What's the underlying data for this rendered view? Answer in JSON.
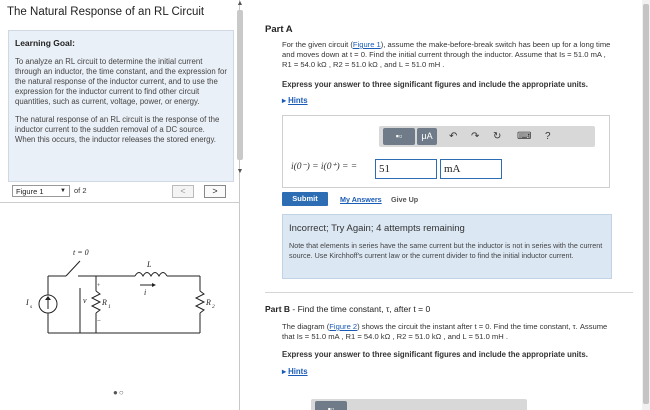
{
  "title": "The Natural Response of an RL Circuit",
  "learning_goal": {
    "heading": "Learning Goal:",
    "p1": "To analyze an RL circuit to determine the initial current through an inductor, the time constant, and the expression for the natural response of the inductor current, and to use the expression for the inductor current to find other circuit quantities, such as current, voltage, power, or energy.",
    "p2": "The natural response of an RL circuit is the response of the inductor current to the sudden removal of a DC source. When this occurs, the inductor releases the stored energy."
  },
  "figure_nav": {
    "select_value": "Figure 1",
    "of_label": "of 2",
    "prev": "<",
    "next": ">"
  },
  "circuit": {
    "switch_label": "t = 0",
    "inductor_label": "L",
    "source_label": "I",
    "source_sub": "s",
    "r1_label": "R",
    "r1_sub": "1",
    "r2_label": "R",
    "r2_sub": "2",
    "v_label": "v",
    "i_label": "i",
    "plus": "+",
    "minus": "−"
  },
  "carousel_dots": "●○",
  "partA": {
    "heading": "Part A",
    "q_pre": "For the given circuit (",
    "q_link": "Figure 1",
    "q_line1": "), assume the make-before-break switch has been up for a long time and moves down at t = 0. Find the initial current through the inductor. Assume that Is = 51.0 mA , R1 = 54.0 kΩ , R2 = 51.0 kΩ , and L = 51.0 mH .",
    "instruction": "Express your answer to three significant figures and include the appropriate units.",
    "hints": "Hints",
    "eq_label": "i(0⁻) = i(0⁺) = =",
    "answer_value": "51",
    "answer_unit": "mA",
    "submit": "Submit",
    "my_answers": "My Answers",
    "give_up": "Give Up"
  },
  "toolbar_icons": [
    "template-icon",
    "mu-A-units-icon",
    "undo-icon",
    "redo-icon",
    "reset-icon",
    "keyboard-icon",
    "help-icon"
  ],
  "toolbar_glyphs": {
    "units": "μA",
    "undo": "↶",
    "redo": "↷",
    "reset": "↻",
    "keyboard": "⌨",
    "help": "?"
  },
  "feedback": {
    "title": "Incorrect; Try Again; 4 attempts remaining",
    "body": "Note that elements in series have the same current but the inductor is not in series with the current source. Use Kirchhoff's current law or the current divider to find the initial inductor current."
  },
  "partB": {
    "heading_bold": "Part B",
    "heading_rest": " - Find the time constant, τ, after t = 0",
    "q_pre": "The diagram (",
    "q_link": "Figure 2",
    "q_line1": ") shows the circuit the instant after t = 0. Find the time constant, τ. Assume that Is = 51.0 mA , R1 = 54.0 kΩ , R2 = 51.0 kΩ , and L = 51.0 mH .",
    "instruction": "Express your answer to three significant figures and include the appropriate units.",
    "hints": "Hints"
  },
  "colors": {
    "accent": "#2c6db4",
    "link": "#1a5bb5",
    "feedback_bg": "#dbe7f3",
    "goal_bg": "#eaf0f7"
  }
}
